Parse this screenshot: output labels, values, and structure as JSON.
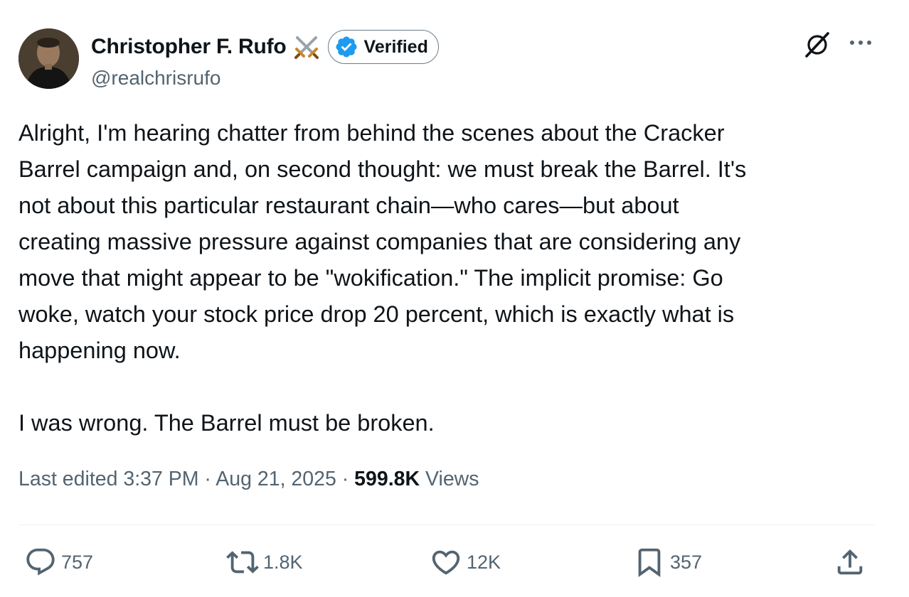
{
  "author": {
    "display_name": "Christopher F. Rufo",
    "name_emoji": "crossed-swords-icon",
    "badge_label": "Verified",
    "handle": "@realchrisrufo"
  },
  "post": {
    "text": "Alright, I'm hearing chatter from behind the scenes about the Cracker\nBarrel campaign and, on second thought: we must break the Barrel. It's\nnot about this particular restaurant chain—who cares—but about\ncreating massive pressure against companies that are considering any\nmove that might appear to be \"wokification.\" The implicit promise: Go\nwoke, watch your stock price drop 20 percent, which is exactly what is\nhappening now.\n\nI was wrong. The Barrel must be broken."
  },
  "meta": {
    "edited": "Last edited 3:37 PM",
    "separator": " · ",
    "date": "Aug 21, 2025",
    "views_count": "599.8K",
    "views_label": "Views"
  },
  "actions": {
    "replies": "757",
    "reposts": "1.8K",
    "likes": "12K",
    "bookmarks": "357"
  },
  "colors": {
    "text_primary": "#0f1419",
    "text_secondary": "#536471",
    "verified_blue": "#1d9bf0",
    "divider": "#eff3f4"
  }
}
